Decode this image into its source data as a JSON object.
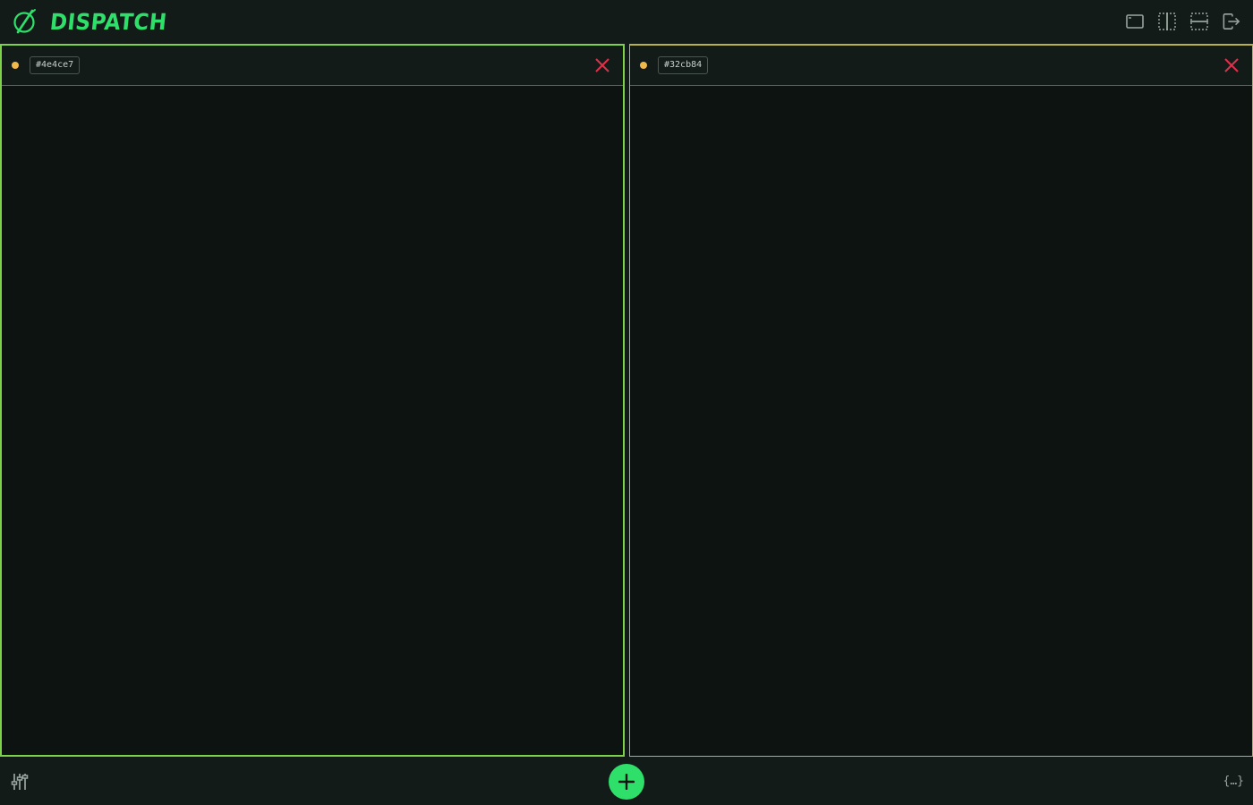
{
  "app": {
    "name": "DISPATCH"
  },
  "toolbar": {
    "icons": [
      "single-layout-icon",
      "split-vertical-icon",
      "split-horizontal-icon",
      "logout-icon"
    ]
  },
  "panes": [
    {
      "session_id": "#4e4ce7",
      "status": "pending",
      "status_color": "#f0b94a",
      "border_color": "#7dd24a",
      "active": true
    },
    {
      "session_id": "#32cb84",
      "status": "pending",
      "status_color": "#f0b94a",
      "border_color": "#b9b04a",
      "active": false
    }
  ],
  "footer": {
    "settings_icon": "sliders-icon",
    "add_icon": "plus-icon",
    "json_label": "{…}"
  },
  "colors": {
    "background": "#131b19",
    "pane_background": "#0d1311",
    "accent": "#2ee06a",
    "close": "#e0304a"
  }
}
